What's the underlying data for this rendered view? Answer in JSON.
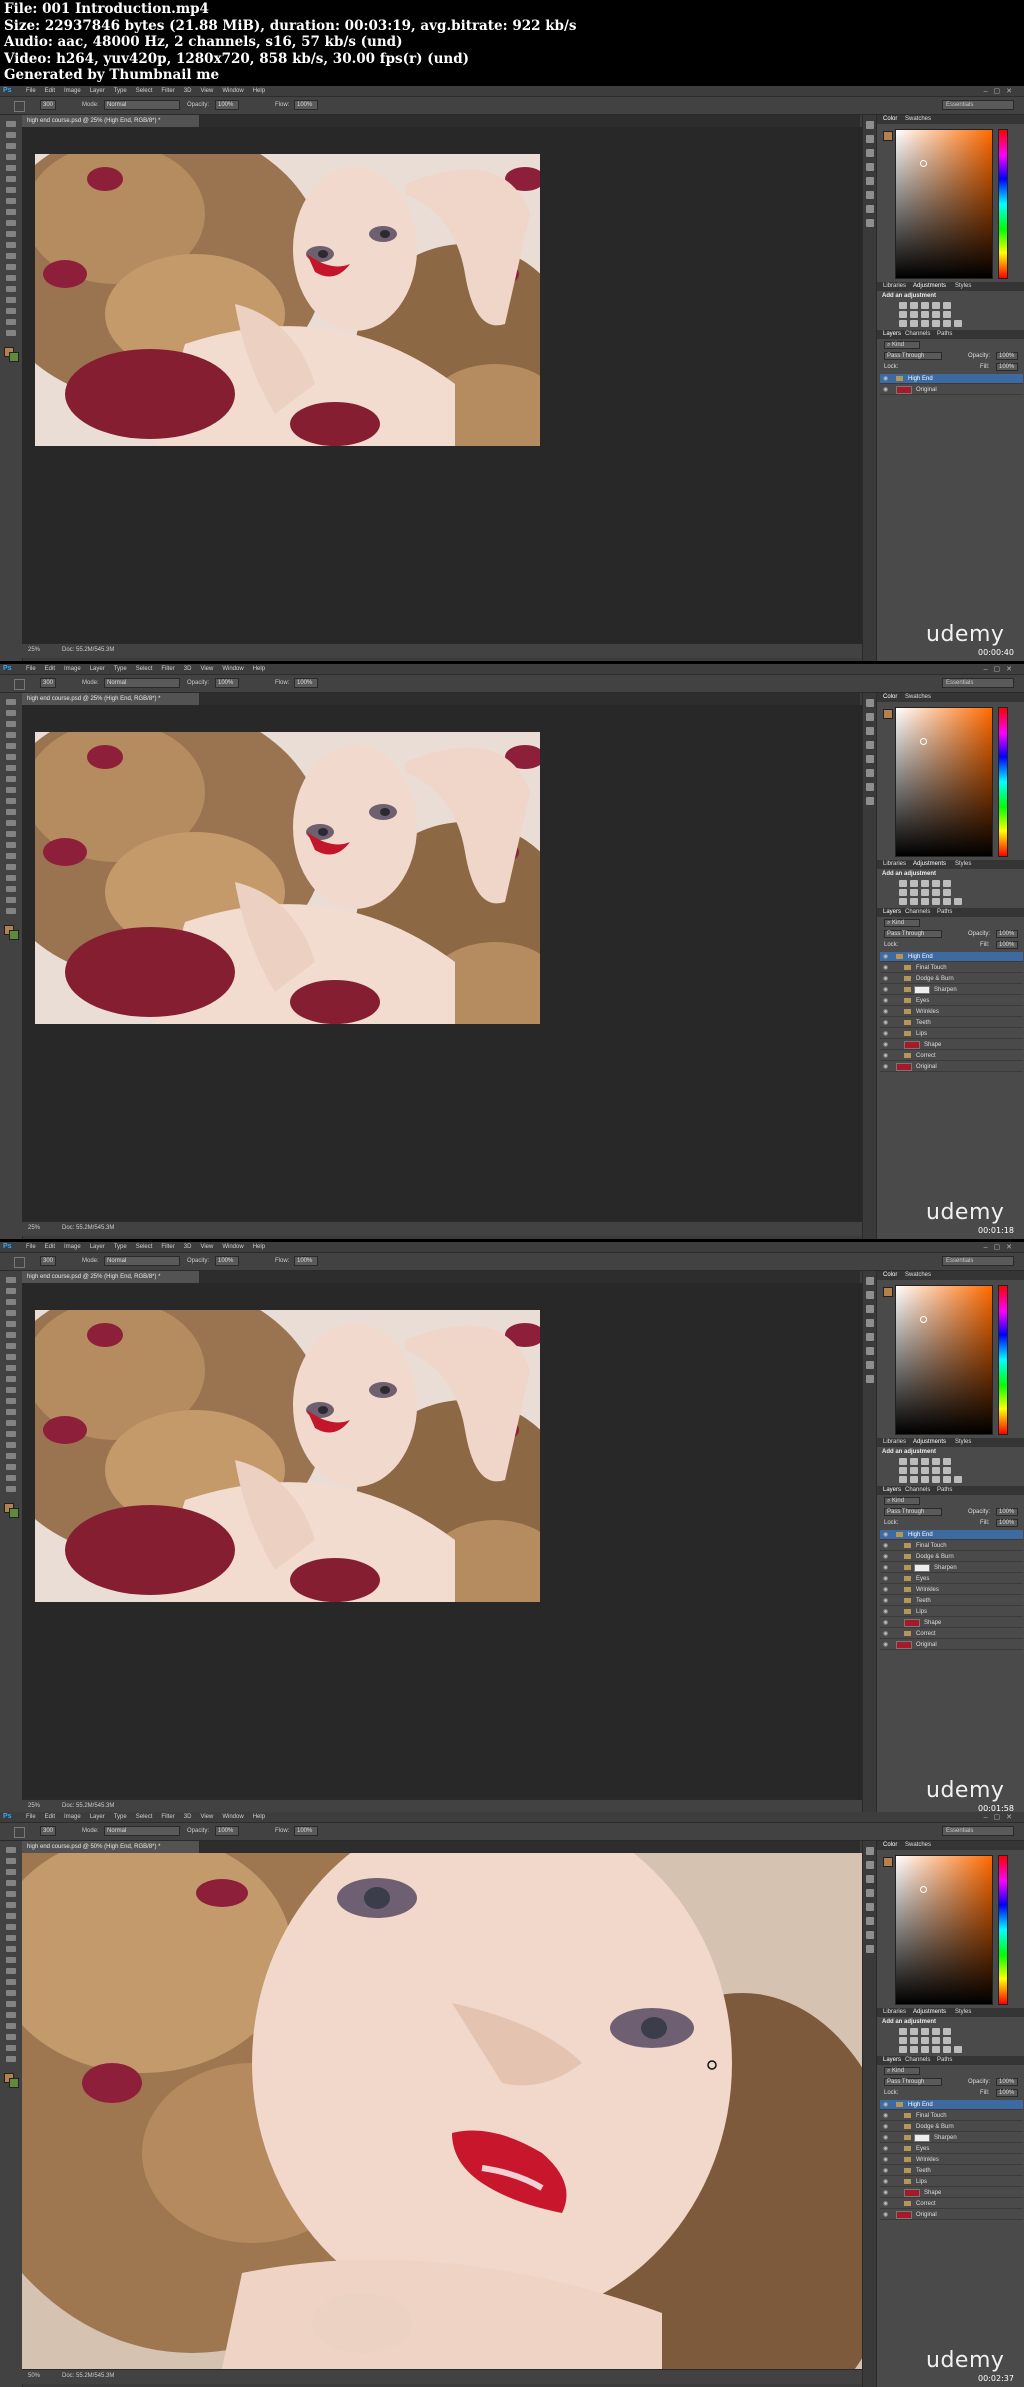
{
  "header": {
    "lines": [
      "File: 001 Introduction.mp4",
      "Size: 22937846 bytes (21.88 MiB), duration: 00:03:19, avg.bitrate: 922 kb/s",
      "Audio: aac, 48000 Hz, 2 channels, s16, 57 kb/s (und)",
      "Video: h264, yuv420p, 1280x720, 858 kb/s, 30.00 fps(r) (und)",
      "Generated by Thumbnail me"
    ]
  },
  "app": {
    "logo": "Ps",
    "menu": [
      "File",
      "Edit",
      "Image",
      "Layer",
      "Type",
      "Select",
      "Filter",
      "3D",
      "View",
      "Window",
      "Help"
    ],
    "options": {
      "brush_size": "300",
      "mode_label": "Mode:",
      "mode_value": "Normal",
      "opacity_label": "Opacity:",
      "opacity_value": "100%",
      "flow_label": "Flow:",
      "flow_value": "100%",
      "workspace": "Essentials"
    },
    "panels": {
      "color_tabs": [
        "Color",
        "Swatches"
      ],
      "adj_tabs": [
        "Libraries",
        "Adjustments",
        "Styles"
      ],
      "adj_title": "Add an adjustment",
      "layers_tabs": [
        "Layers",
        "Channels",
        "Paths"
      ],
      "kind_label": "Kind",
      "blend_value": "Pass Through",
      "opacity_label": "Opacity:",
      "opacity_value": "100%",
      "lock_label": "Lock:",
      "fill_label": "Fill:",
      "fill_value": "100%"
    },
    "accent_color": "#3d6aa0",
    "fg_color": "#b3814f",
    "bg_color": "#5f8a3c"
  },
  "frames": [
    {
      "doc_tab": "high end course.psd @ 25% (High End, RGB/8*) *",
      "status": "25%",
      "doc_size": "Doc: 55.2M/545.3M",
      "timecode": "00:00:40",
      "watermark": "udemy",
      "layers": [
        {
          "name": "High End",
          "kind": "folder",
          "selected": true,
          "indent": 0
        },
        {
          "name": "Original",
          "kind": "image",
          "selected": false,
          "indent": 0
        }
      ]
    },
    {
      "doc_tab": "high end course.psd @ 25% (High End, RGB/8*) *",
      "status": "25%",
      "doc_size": "Doc: 55.2M/545.3M",
      "timecode": "00:01:18",
      "watermark": "udemy",
      "layers": [
        {
          "name": "High End",
          "kind": "folder",
          "selected": true,
          "indent": 0
        },
        {
          "name": "Final Touch",
          "kind": "folder",
          "selected": false,
          "indent": 1
        },
        {
          "name": "Dodge & Burn",
          "kind": "folder",
          "selected": false,
          "indent": 1
        },
        {
          "name": "Sharpen",
          "kind": "masked",
          "selected": false,
          "indent": 1
        },
        {
          "name": "Eyes",
          "kind": "folder",
          "selected": false,
          "indent": 1
        },
        {
          "name": "Wrinkles",
          "kind": "folder",
          "selected": false,
          "indent": 1
        },
        {
          "name": "Teeth",
          "kind": "folder",
          "selected": false,
          "indent": 1
        },
        {
          "name": "Lips",
          "kind": "folder",
          "selected": false,
          "indent": 1
        },
        {
          "name": "Shape",
          "kind": "image",
          "selected": false,
          "indent": 1
        },
        {
          "name": "Correct",
          "kind": "folder",
          "selected": false,
          "indent": 1
        },
        {
          "name": "Original",
          "kind": "image",
          "selected": false,
          "indent": 0
        }
      ]
    },
    {
      "doc_tab": "high end course.psd @ 25% (High End, RGB/8*) *",
      "status": "25%",
      "doc_size": "Doc: 55.2M/545.3M",
      "timecode": "00:01:58",
      "watermark": "udemy",
      "layers": [
        {
          "name": "High End",
          "kind": "folder",
          "selected": true,
          "indent": 0
        },
        {
          "name": "Final Touch",
          "kind": "folder",
          "selected": false,
          "indent": 1
        },
        {
          "name": "Dodge & Burn",
          "kind": "folder",
          "selected": false,
          "indent": 1
        },
        {
          "name": "Sharpen",
          "kind": "masked",
          "selected": false,
          "indent": 1
        },
        {
          "name": "Eyes",
          "kind": "folder",
          "selected": false,
          "indent": 1
        },
        {
          "name": "Wrinkles",
          "kind": "folder",
          "selected": false,
          "indent": 1
        },
        {
          "name": "Teeth",
          "kind": "folder",
          "selected": false,
          "indent": 1
        },
        {
          "name": "Lips",
          "kind": "folder",
          "selected": false,
          "indent": 1
        },
        {
          "name": "Shape",
          "kind": "image",
          "selected": false,
          "indent": 1
        },
        {
          "name": "Correct",
          "kind": "folder",
          "selected": false,
          "indent": 1
        },
        {
          "name": "Original",
          "kind": "image",
          "selected": false,
          "indent": 0
        }
      ]
    },
    {
      "doc_tab": "high end course.psd @ 50% (High End, RGB/8*) *",
      "status": "50%",
      "doc_size": "Doc: 55.2M/545.3M",
      "timecode": "00:02:37",
      "watermark": "udemy",
      "layers": [
        {
          "name": "High End",
          "kind": "folder",
          "selected": true,
          "indent": 0
        },
        {
          "name": "Final Touch",
          "kind": "folder",
          "selected": false,
          "indent": 1
        },
        {
          "name": "Dodge & Burn",
          "kind": "folder",
          "selected": false,
          "indent": 1
        },
        {
          "name": "Sharpen",
          "kind": "masked",
          "selected": false,
          "indent": 1
        },
        {
          "name": "Eyes",
          "kind": "folder",
          "selected": false,
          "indent": 1
        },
        {
          "name": "Wrinkles",
          "kind": "folder",
          "selected": false,
          "indent": 1
        },
        {
          "name": "Teeth",
          "kind": "folder",
          "selected": false,
          "indent": 1
        },
        {
          "name": "Lips",
          "kind": "folder",
          "selected": false,
          "indent": 1
        },
        {
          "name": "Shape",
          "kind": "image",
          "selected": false,
          "indent": 1
        },
        {
          "name": "Correct",
          "kind": "folder",
          "selected": false,
          "indent": 1
        },
        {
          "name": "Original",
          "kind": "image",
          "selected": false,
          "indent": 0
        }
      ]
    }
  ]
}
